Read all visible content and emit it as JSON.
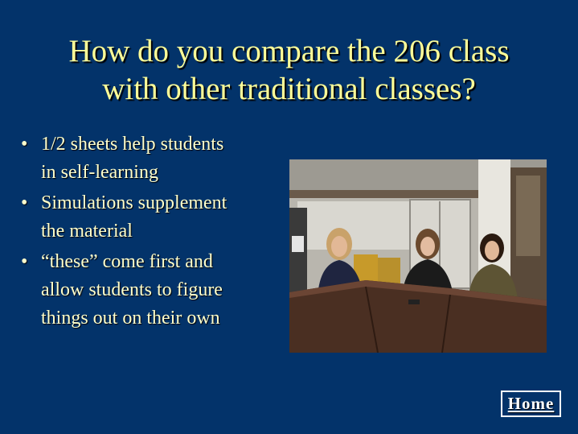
{
  "slide": {
    "title_line1": "How do you compare the 206 class",
    "title_line2": "with other traditional classes?",
    "bullets": [
      {
        "line1": "1/2 sheets help students",
        "line2": "in self-learning"
      },
      {
        "line1": "Simulations supplement",
        "line2": "the material"
      },
      {
        "line1": "“these” come first and",
        "line2": "allow students to figure",
        "line3": "things out on their own"
      }
    ],
    "bullet_char": "•"
  },
  "nav": {
    "home_label": "Home"
  },
  "colors": {
    "background": "#03336a",
    "title": "#ffff99",
    "text": "#ffffcc"
  }
}
